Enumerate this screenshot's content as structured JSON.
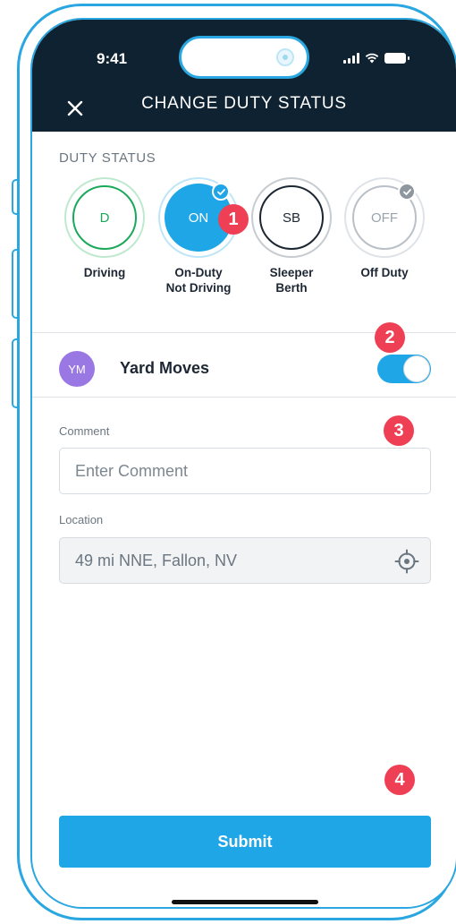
{
  "status_bar": {
    "time": "9:41"
  },
  "header": {
    "title": "CHANGE DUTY STATUS"
  },
  "duty_status": {
    "section_label": "DUTY STATUS",
    "options": [
      {
        "code": "D",
        "label_line1": "Driving",
        "label_line2": "",
        "selected": false,
        "checked": false
      },
      {
        "code": "ON",
        "label_line1": "On-Duty",
        "label_line2": "Not Driving",
        "selected": true,
        "checked": true
      },
      {
        "code": "SB",
        "label_line1": "Sleeper",
        "label_line2": "Berth",
        "selected": false,
        "checked": false
      },
      {
        "code": "OFF",
        "label_line1": "Off Duty",
        "label_line2": "",
        "selected": false,
        "checked": true
      }
    ]
  },
  "yard_moves": {
    "avatar_initials": "YM",
    "label": "Yard Moves",
    "enabled": true
  },
  "comment": {
    "label": "Comment",
    "placeholder": "Enter Comment",
    "value": ""
  },
  "location": {
    "label": "Location",
    "value": "49 mi NNE, Fallon, NV"
  },
  "submit_label": "Submit",
  "callouts": [
    "1",
    "2",
    "3",
    "4"
  ],
  "colors": {
    "header_bg": "#0f2231",
    "accent": "#1fa6e6",
    "driving_green": "#1aa85a",
    "callout_red": "#ef3f54",
    "avatar_purple": "#9a78e4",
    "frame_blue": "#2aa7e0"
  }
}
